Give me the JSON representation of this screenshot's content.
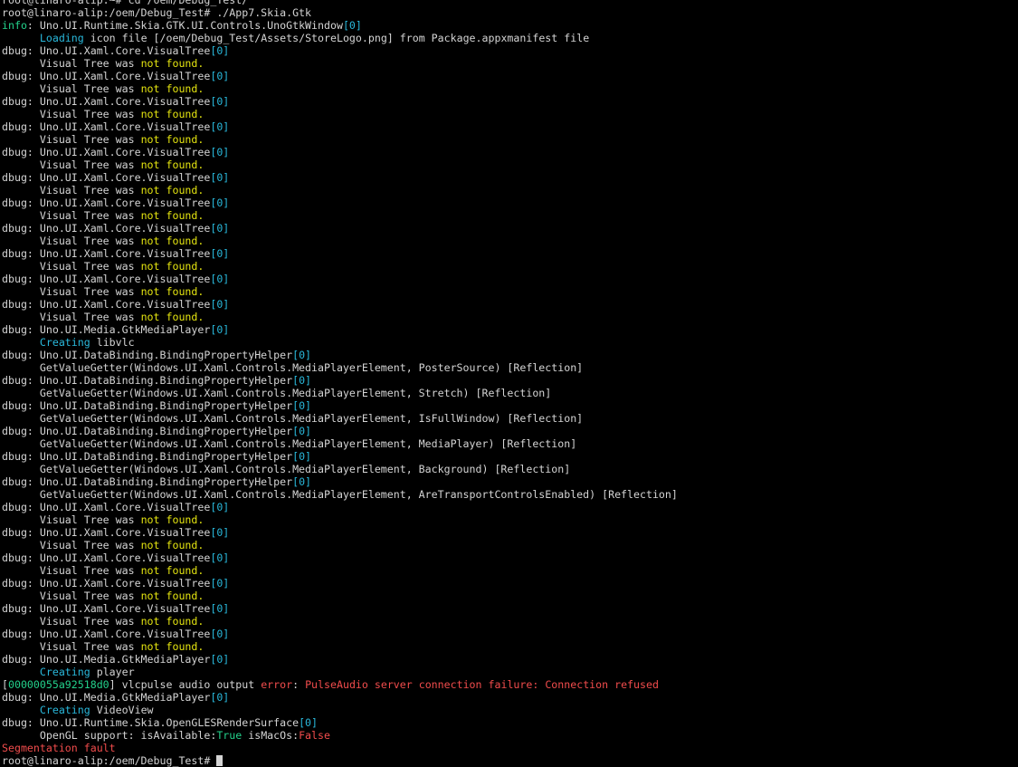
{
  "window": {
    "colors": {
      "background": "#000000",
      "default": "#d4d4d4",
      "info": "#23d18b",
      "cyan": "#29b8db",
      "yellow": "#e5e510",
      "red": "#f14c4c",
      "green": "#23d18b"
    }
  },
  "lines": [
    {
      "segments": [
        {
          "text": "root@linaro-alip:~# cd /oem/Debug_Test/",
          "color": "default"
        }
      ]
    },
    {
      "segments": [
        {
          "text": "root@linaro-alip:/oem/Debug_Test# ./App7.Skia.Gtk",
          "color": "default"
        }
      ]
    },
    {
      "segments": [
        {
          "text": "info",
          "color": "info"
        },
        {
          "text": ": Uno.UI.Runtime.Skia.GTK.UI.Controls.UnoGtkWindow",
          "color": "default"
        },
        {
          "text": "[0]",
          "color": "cyan"
        }
      ]
    },
    {
      "segments": [
        {
          "text": "      ",
          "color": "default"
        },
        {
          "text": "Loading",
          "color": "cyan"
        },
        {
          "text": " icon file [/oem/Debug_Test/Assets/StoreLogo.png] from Package.appxmanifest file",
          "color": "default"
        }
      ]
    },
    {
      "segments": [
        {
          "text": "dbug: Uno.UI.Xaml.Core.VisualTree",
          "color": "default"
        },
        {
          "text": "[0]",
          "color": "cyan"
        }
      ]
    },
    {
      "segments": [
        {
          "text": "      Visual Tree was ",
          "color": "default"
        },
        {
          "text": "not found.",
          "color": "yellow"
        }
      ]
    },
    {
      "segments": [
        {
          "text": "dbug: Uno.UI.Xaml.Core.VisualTree",
          "color": "default"
        },
        {
          "text": "[0]",
          "color": "cyan"
        }
      ]
    },
    {
      "segments": [
        {
          "text": "      Visual Tree was ",
          "color": "default"
        },
        {
          "text": "not found.",
          "color": "yellow"
        }
      ]
    },
    {
      "segments": [
        {
          "text": "dbug: Uno.UI.Xaml.Core.VisualTree",
          "color": "default"
        },
        {
          "text": "[0]",
          "color": "cyan"
        }
      ]
    },
    {
      "segments": [
        {
          "text": "      Visual Tree was ",
          "color": "default"
        },
        {
          "text": "not found.",
          "color": "yellow"
        }
      ]
    },
    {
      "segments": [
        {
          "text": "dbug: Uno.UI.Xaml.Core.VisualTree",
          "color": "default"
        },
        {
          "text": "[0]",
          "color": "cyan"
        }
      ]
    },
    {
      "segments": [
        {
          "text": "      Visual Tree was ",
          "color": "default"
        },
        {
          "text": "not found.",
          "color": "yellow"
        }
      ]
    },
    {
      "segments": [
        {
          "text": "dbug: Uno.UI.Xaml.Core.VisualTree",
          "color": "default"
        },
        {
          "text": "[0]",
          "color": "cyan"
        }
      ]
    },
    {
      "segments": [
        {
          "text": "      Visual Tree was ",
          "color": "default"
        },
        {
          "text": "not found.",
          "color": "yellow"
        }
      ]
    },
    {
      "segments": [
        {
          "text": "dbug: Uno.UI.Xaml.Core.VisualTree",
          "color": "default"
        },
        {
          "text": "[0]",
          "color": "cyan"
        }
      ]
    },
    {
      "segments": [
        {
          "text": "      Visual Tree was ",
          "color": "default"
        },
        {
          "text": "not found.",
          "color": "yellow"
        }
      ]
    },
    {
      "segments": [
        {
          "text": "dbug: Uno.UI.Xaml.Core.VisualTree",
          "color": "default"
        },
        {
          "text": "[0]",
          "color": "cyan"
        }
      ]
    },
    {
      "segments": [
        {
          "text": "      Visual Tree was ",
          "color": "default"
        },
        {
          "text": "not found.",
          "color": "yellow"
        }
      ]
    },
    {
      "segments": [
        {
          "text": "dbug: Uno.UI.Xaml.Core.VisualTree",
          "color": "default"
        },
        {
          "text": "[0]",
          "color": "cyan"
        }
      ]
    },
    {
      "segments": [
        {
          "text": "      Visual Tree was ",
          "color": "default"
        },
        {
          "text": "not found.",
          "color": "yellow"
        }
      ]
    },
    {
      "segments": [
        {
          "text": "dbug: Uno.UI.Xaml.Core.VisualTree",
          "color": "default"
        },
        {
          "text": "[0]",
          "color": "cyan"
        }
      ]
    },
    {
      "segments": [
        {
          "text": "      Visual Tree was ",
          "color": "default"
        },
        {
          "text": "not found.",
          "color": "yellow"
        }
      ]
    },
    {
      "segments": [
        {
          "text": "dbug: Uno.UI.Xaml.Core.VisualTree",
          "color": "default"
        },
        {
          "text": "[0]",
          "color": "cyan"
        }
      ]
    },
    {
      "segments": [
        {
          "text": "      Visual Tree was ",
          "color": "default"
        },
        {
          "text": "not found.",
          "color": "yellow"
        }
      ]
    },
    {
      "segments": [
        {
          "text": "dbug: Uno.UI.Xaml.Core.VisualTree",
          "color": "default"
        },
        {
          "text": "[0]",
          "color": "cyan"
        }
      ]
    },
    {
      "segments": [
        {
          "text": "      Visual Tree was ",
          "color": "default"
        },
        {
          "text": "not found.",
          "color": "yellow"
        }
      ]
    },
    {
      "segments": [
        {
          "text": "dbug: Uno.UI.Media.GtkMediaPlayer",
          "color": "default"
        },
        {
          "text": "[0]",
          "color": "cyan"
        }
      ]
    },
    {
      "segments": [
        {
          "text": "      ",
          "color": "default"
        },
        {
          "text": "Creating",
          "color": "cyan"
        },
        {
          "text": " libvlc",
          "color": "default"
        }
      ]
    },
    {
      "segments": [
        {
          "text": "dbug: Uno.UI.DataBinding.BindingPropertyHelper",
          "color": "default"
        },
        {
          "text": "[0]",
          "color": "cyan"
        }
      ]
    },
    {
      "segments": [
        {
          "text": "      GetValueGetter(Windows.UI.Xaml.Controls.MediaPlayerElement, PosterSource) [Reflection]",
          "color": "default"
        }
      ]
    },
    {
      "segments": [
        {
          "text": "dbug: Uno.UI.DataBinding.BindingPropertyHelper",
          "color": "default"
        },
        {
          "text": "[0]",
          "color": "cyan"
        }
      ]
    },
    {
      "segments": [
        {
          "text": "      GetValueGetter(Windows.UI.Xaml.Controls.MediaPlayerElement, Stretch) [Reflection]",
          "color": "default"
        }
      ]
    },
    {
      "segments": [
        {
          "text": "dbug: Uno.UI.DataBinding.BindingPropertyHelper",
          "color": "default"
        },
        {
          "text": "[0]",
          "color": "cyan"
        }
      ]
    },
    {
      "segments": [
        {
          "text": "      GetValueGetter(Windows.UI.Xaml.Controls.MediaPlayerElement, IsFullWindow) [Reflection]",
          "color": "default"
        }
      ]
    },
    {
      "segments": [
        {
          "text": "dbug: Uno.UI.DataBinding.BindingPropertyHelper",
          "color": "default"
        },
        {
          "text": "[0]",
          "color": "cyan"
        }
      ]
    },
    {
      "segments": [
        {
          "text": "      GetValueGetter(Windows.UI.Xaml.Controls.MediaPlayerElement, MediaPlayer) [Reflection]",
          "color": "default"
        }
      ]
    },
    {
      "segments": [
        {
          "text": "dbug: Uno.UI.DataBinding.BindingPropertyHelper",
          "color": "default"
        },
        {
          "text": "[0]",
          "color": "cyan"
        }
      ]
    },
    {
      "segments": [
        {
          "text": "      GetValueGetter(Windows.UI.Xaml.Controls.MediaPlayerElement, Background) [Reflection]",
          "color": "default"
        }
      ]
    },
    {
      "segments": [
        {
          "text": "dbug: Uno.UI.DataBinding.BindingPropertyHelper",
          "color": "default"
        },
        {
          "text": "[0]",
          "color": "cyan"
        }
      ]
    },
    {
      "segments": [
        {
          "text": "      GetValueGetter(Windows.UI.Xaml.Controls.MediaPlayerElement, AreTransportControlsEnabled) [Reflection]",
          "color": "default"
        }
      ]
    },
    {
      "segments": [
        {
          "text": "dbug: Uno.UI.Xaml.Core.VisualTree",
          "color": "default"
        },
        {
          "text": "[0]",
          "color": "cyan"
        }
      ]
    },
    {
      "segments": [
        {
          "text": "      Visual Tree was ",
          "color": "default"
        },
        {
          "text": "not found.",
          "color": "yellow"
        }
      ]
    },
    {
      "segments": [
        {
          "text": "dbug: Uno.UI.Xaml.Core.VisualTree",
          "color": "default"
        },
        {
          "text": "[0]",
          "color": "cyan"
        }
      ]
    },
    {
      "segments": [
        {
          "text": "      Visual Tree was ",
          "color": "default"
        },
        {
          "text": "not found.",
          "color": "yellow"
        }
      ]
    },
    {
      "segments": [
        {
          "text": "dbug: Uno.UI.Xaml.Core.VisualTree",
          "color": "default"
        },
        {
          "text": "[0]",
          "color": "cyan"
        }
      ]
    },
    {
      "segments": [
        {
          "text": "      Visual Tree was ",
          "color": "default"
        },
        {
          "text": "not found.",
          "color": "yellow"
        }
      ]
    },
    {
      "segments": [
        {
          "text": "dbug: Uno.UI.Xaml.Core.VisualTree",
          "color": "default"
        },
        {
          "text": "[0]",
          "color": "cyan"
        }
      ]
    },
    {
      "segments": [
        {
          "text": "      Visual Tree was ",
          "color": "default"
        },
        {
          "text": "not found.",
          "color": "yellow"
        }
      ]
    },
    {
      "segments": [
        {
          "text": "dbug: Uno.UI.Xaml.Core.VisualTree",
          "color": "default"
        },
        {
          "text": "[0]",
          "color": "cyan"
        }
      ]
    },
    {
      "segments": [
        {
          "text": "      Visual Tree was ",
          "color": "default"
        },
        {
          "text": "not found.",
          "color": "yellow"
        }
      ]
    },
    {
      "segments": [
        {
          "text": "dbug: Uno.UI.Xaml.Core.VisualTree",
          "color": "default"
        },
        {
          "text": "[0]",
          "color": "cyan"
        }
      ]
    },
    {
      "segments": [
        {
          "text": "      Visual Tree was ",
          "color": "default"
        },
        {
          "text": "not found.",
          "color": "yellow"
        }
      ]
    },
    {
      "segments": [
        {
          "text": "dbug: Uno.UI.Media.GtkMediaPlayer",
          "color": "default"
        },
        {
          "text": "[0]",
          "color": "cyan"
        }
      ]
    },
    {
      "segments": [
        {
          "text": "      ",
          "color": "default"
        },
        {
          "text": "Creating",
          "color": "cyan"
        },
        {
          "text": " player",
          "color": "default"
        }
      ]
    },
    {
      "segments": [
        {
          "text": "[",
          "color": "default"
        },
        {
          "text": "00000055a92518d0",
          "color": "green"
        },
        {
          "text": "] vlcpulse audio output ",
          "color": "default"
        },
        {
          "text": "error",
          "color": "red"
        },
        {
          "text": ": ",
          "color": "default"
        },
        {
          "text": "PulseAudio server connection failure: Connection refused",
          "color": "red"
        }
      ]
    },
    {
      "segments": [
        {
          "text": "dbug: Uno.UI.Media.GtkMediaPlayer",
          "color": "default"
        },
        {
          "text": "[0]",
          "color": "cyan"
        }
      ]
    },
    {
      "segments": [
        {
          "text": "      ",
          "color": "default"
        },
        {
          "text": "Creating",
          "color": "cyan"
        },
        {
          "text": " VideoView",
          "color": "default"
        }
      ]
    },
    {
      "segments": [
        {
          "text": "dbug: Uno.UI.Runtime.Skia.OpenGLESRenderSurface",
          "color": "default"
        },
        {
          "text": "[0]",
          "color": "cyan"
        }
      ]
    },
    {
      "segments": [
        {
          "text": "      OpenGL support: isAvailable:",
          "color": "default"
        },
        {
          "text": "True",
          "color": "green"
        },
        {
          "text": " isMacOs:",
          "color": "default"
        },
        {
          "text": "False",
          "color": "red"
        }
      ]
    },
    {
      "segments": [
        {
          "text": "Segmentation fault",
          "color": "red"
        }
      ]
    },
    {
      "segments": [
        {
          "text": "root@linaro-alip:/oem/Debug_Test# ",
          "color": "default"
        }
      ],
      "cursor": true
    }
  ]
}
